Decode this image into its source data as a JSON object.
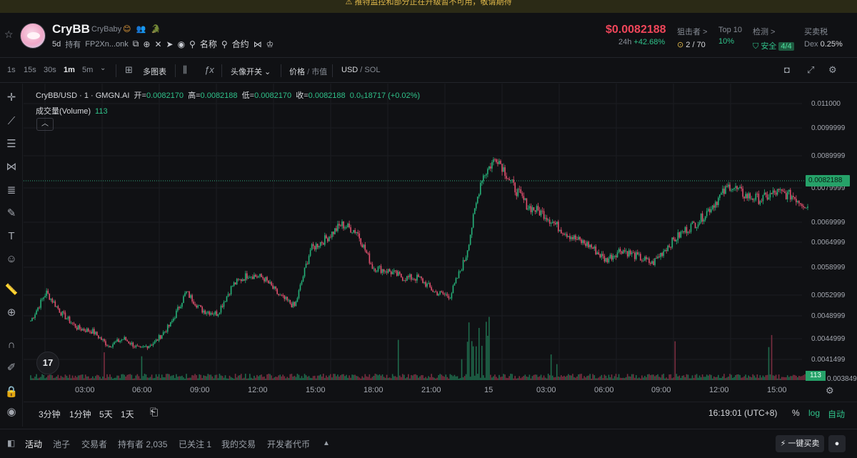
{
  "banner": {
    "text": "⚠ 推特监控和部分正在升级暂不可用，敬请期待"
  },
  "header": {
    "name": "CryBB",
    "subname": "CryBaby",
    "badges": "😊 👥 🐊",
    "age": "5d",
    "holding_label": "持有",
    "address": "FP2Xn...onk",
    "name_search": "名称",
    "contract_search": "合约",
    "price": "$0.0082188",
    "change_label": "24h",
    "change_value": "+42.68%",
    "stats": [
      {
        "label": "狙击者 >",
        "value": "2 / 70"
      },
      {
        "label": "Top 10",
        "value": "10%"
      },
      {
        "label": "检测 >",
        "value": "安全",
        "tag": "4/4"
      },
      {
        "label": "买卖税",
        "value_label": "Dex",
        "value": "0.25%"
      }
    ]
  },
  "toolbar": {
    "intervals": [
      "1s",
      "15s",
      "30s",
      "1m",
      "5m"
    ],
    "active_interval": "1m",
    "multi_chart": "多图表",
    "avatar_toggle": "头像开关",
    "price_label": "价格",
    "mcap_label": "市值",
    "usd_label": "USD",
    "sol_label": "SOL"
  },
  "legend": {
    "symbol": "CryBB/USD · 1 · GMGN.AI",
    "open_label": "开=",
    "open": "0.0082170",
    "high_label": "高=",
    "high": "0.0082188",
    "low_label": "低=",
    "low": "0.0082170",
    "close_label": "收=",
    "close": "0.0082188",
    "change": "0.0₅18717 (+0.02%)",
    "volume_label": "成交量(Volume)",
    "volume_value": "113"
  },
  "chart_data": {
    "type": "candlestick",
    "y_ticks": [
      "0.011000",
      "0.0099999",
      "0.0089999",
      "0.0079999",
      "0.0069999",
      "0.0064999",
      "0.0058999",
      "0.0052999",
      "0.0048999",
      "0.0044999",
      "0.0041499",
      "0.0038499"
    ],
    "x_ticks": [
      "03:00",
      "06:00",
      "09:00",
      "12:00",
      "15:00",
      "18:00",
      "21:00",
      "15",
      "03:00",
      "06:00",
      "09:00",
      "12:00",
      "15:00"
    ],
    "last_price": "0.0082188",
    "last_volume": "113",
    "close_path": [
      0.005,
      0.0058,
      0.0052,
      0.0048,
      0.0047,
      0.0043,
      0.0045,
      0.0042,
      0.0044,
      0.0049,
      0.0058,
      0.0053,
      0.0052,
      0.006,
      0.0063,
      0.0062,
      0.0057,
      0.0054,
      0.007,
      0.0073,
      0.0077,
      0.0075,
      0.0065,
      0.0064,
      0.0062,
      0.0062,
      0.0058,
      0.0057,
      0.0068,
      0.009,
      0.0096,
      0.0088,
      0.0082,
      0.008,
      0.0076,
      0.0073,
      0.0071,
      0.0067,
      0.007,
      0.0068,
      0.0066,
      0.0071,
      0.0075,
      0.0078,
      0.0083,
      0.0088,
      0.0085,
      0.0084,
      0.0086,
      0.0085,
      0.0082
    ]
  },
  "bottombar": {
    "ranges": [
      "3分钟",
      "1分钟",
      "5天",
      "1天"
    ],
    "time": "16:19:01 (UTC+8)",
    "percent": "%",
    "log": "log",
    "auto": "自动"
  },
  "tabs": {
    "items": [
      "活动",
      "池子",
      "交易者",
      "持有者 2,035",
      "已关注 1",
      "我的交易",
      "开发者代币"
    ],
    "quick_sell": "一键买卖"
  }
}
